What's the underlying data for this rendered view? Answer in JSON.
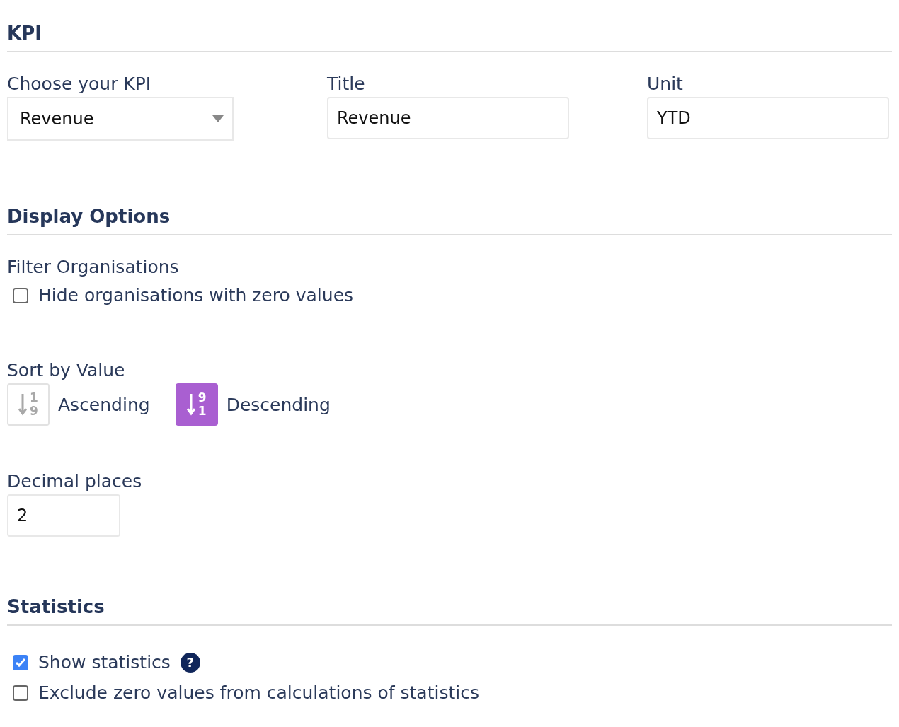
{
  "sections": [
    {
      "kind": "kpi",
      "heading": "KPI",
      "fields": [
        {
          "kind": "select",
          "label": "Choose your KPI",
          "value": "Revenue"
        },
        {
          "kind": "text",
          "label": "Title",
          "value": "Revenue"
        },
        {
          "kind": "text",
          "label": "Unit",
          "value": "YTD"
        }
      ]
    },
    {
      "kind": "display",
      "heading": "Display Options",
      "filter": {
        "label": "Filter Organisations",
        "options": [
          {
            "label": "Hide organisations with zero values",
            "checked": false
          }
        ]
      },
      "sort": {
        "label": "Sort by Value",
        "options": [
          {
            "label": "Ascending",
            "top_digit": "1",
            "bottom_digit": "9",
            "selected": false
          },
          {
            "label": "Descending",
            "top_digit": "9",
            "bottom_digit": "1",
            "selected": true
          }
        ]
      },
      "decimals": {
        "label": "Decimal places",
        "value": "2"
      }
    },
    {
      "kind": "statistics",
      "heading": "Statistics",
      "options": [
        {
          "label": "Show statistics",
          "checked": true,
          "help": "?"
        },
        {
          "label": "Exclude zero values from calculations of statistics",
          "checked": false
        }
      ]
    }
  ]
}
